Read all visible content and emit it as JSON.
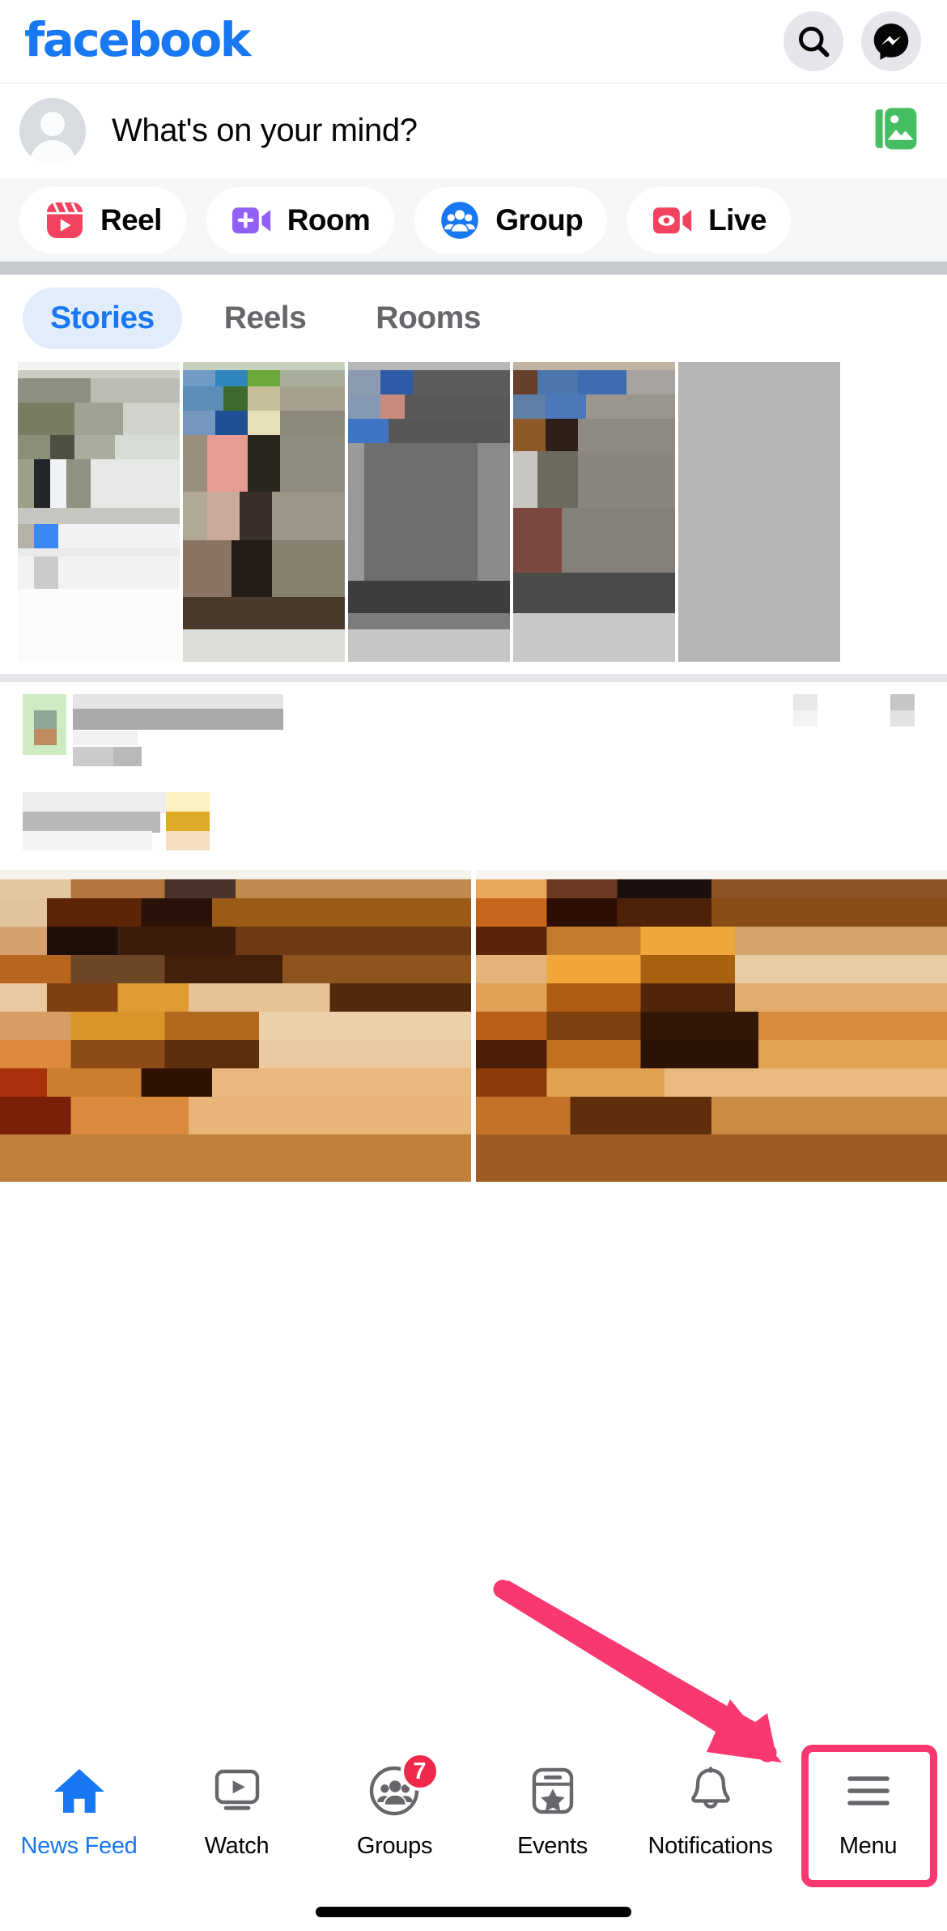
{
  "app": {
    "name": "facebook",
    "brand_color": "#1877f2"
  },
  "header": {
    "logo_text": "facebook",
    "actions": [
      {
        "name": "search-icon",
        "label": "Search"
      },
      {
        "name": "messenger-icon",
        "label": "Messenger"
      }
    ]
  },
  "composer": {
    "placeholder": "What's on your mind?",
    "photo_icon_label": "Photo",
    "photo_icon_color": "#45bd62"
  },
  "quick_actions": [
    {
      "label": "Reel",
      "icon": "reel-icon",
      "color": "#f3425f"
    },
    {
      "label": "Room",
      "icon": "room-icon",
      "color": "#9360f7"
    },
    {
      "label": "Group",
      "icon": "group-icon",
      "color": "#1877f2"
    },
    {
      "label": "Live",
      "icon": "live-icon",
      "color": "#f3425f"
    }
  ],
  "tabs": [
    {
      "label": "Stories",
      "active": true
    },
    {
      "label": "Reels",
      "active": false
    },
    {
      "label": "Rooms",
      "active": false
    }
  ],
  "bottom_nav": [
    {
      "label": "News Feed",
      "icon": "home-icon",
      "active": true,
      "badge": null
    },
    {
      "label": "Watch",
      "icon": "watch-icon",
      "active": false,
      "badge": null
    },
    {
      "label": "Groups",
      "icon": "groups-icon",
      "active": false,
      "badge": "7"
    },
    {
      "label": "Events",
      "icon": "events-icon",
      "active": false,
      "badge": null
    },
    {
      "label": "Notifications",
      "icon": "notifications-icon",
      "active": false,
      "badge": null
    },
    {
      "label": "Menu",
      "icon": "hamburger-icon",
      "active": false,
      "badge": null
    }
  ],
  "annotation": {
    "highlight_target": "Menu",
    "highlight_color": "#f9386f",
    "arrow_color": "#f9386f"
  }
}
